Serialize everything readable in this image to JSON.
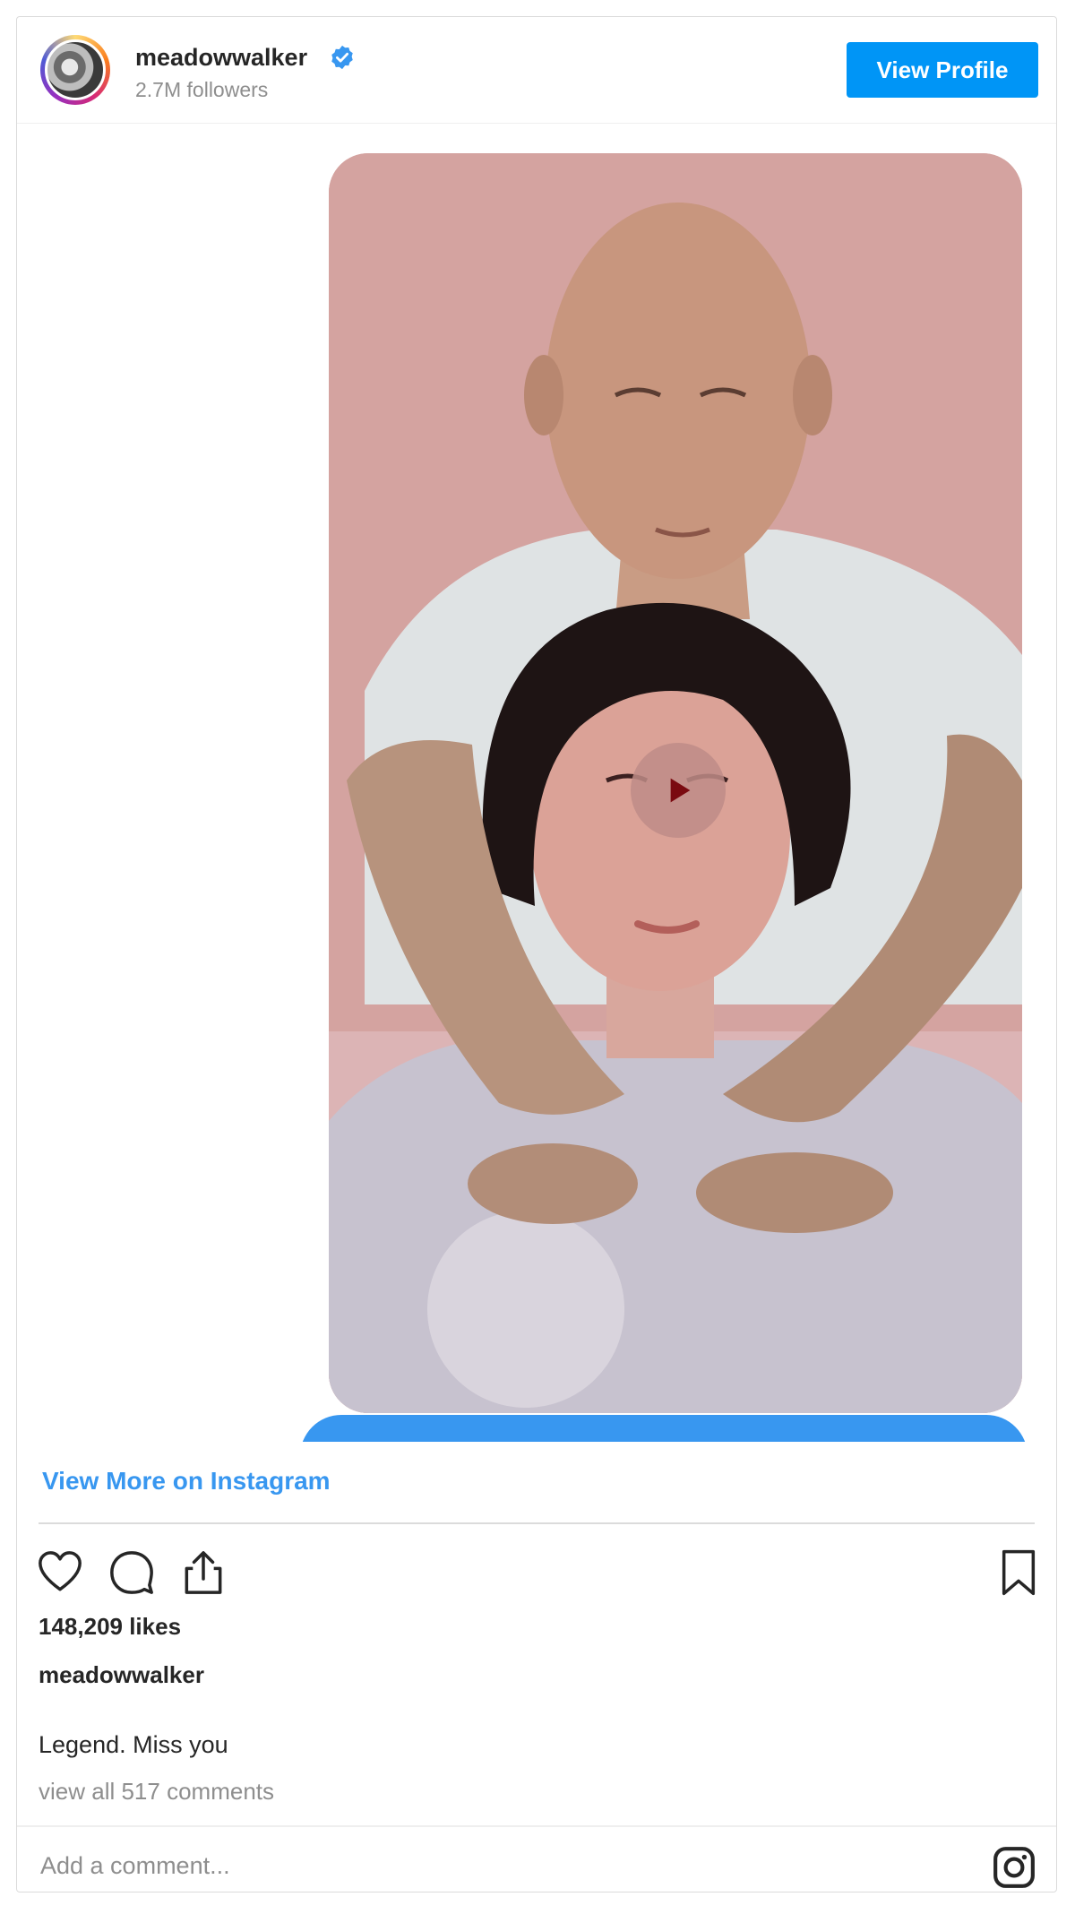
{
  "header": {
    "username": "meadowwalker",
    "followers": "2.7M followers",
    "view_profile_label": "View Profile"
  },
  "post": {
    "view_more_label": "View More on Instagram",
    "likes": "148,209 likes",
    "caption_user": "meadowwalker",
    "caption": "Legend. Miss you",
    "view_comments": "view all 517 comments",
    "comment_placeholder": "Add a comment..."
  },
  "icons": {
    "like": "heart-icon",
    "comment": "comment-icon",
    "share": "share-icon",
    "save": "bookmark-icon",
    "verified": "verified-badge-icon",
    "play": "play-icon",
    "instagram": "instagram-logo-icon"
  },
  "colors": {
    "accent": "#0095f6",
    "link": "#3897f0",
    "muted": "#8e8e8e",
    "text": "#262626"
  }
}
